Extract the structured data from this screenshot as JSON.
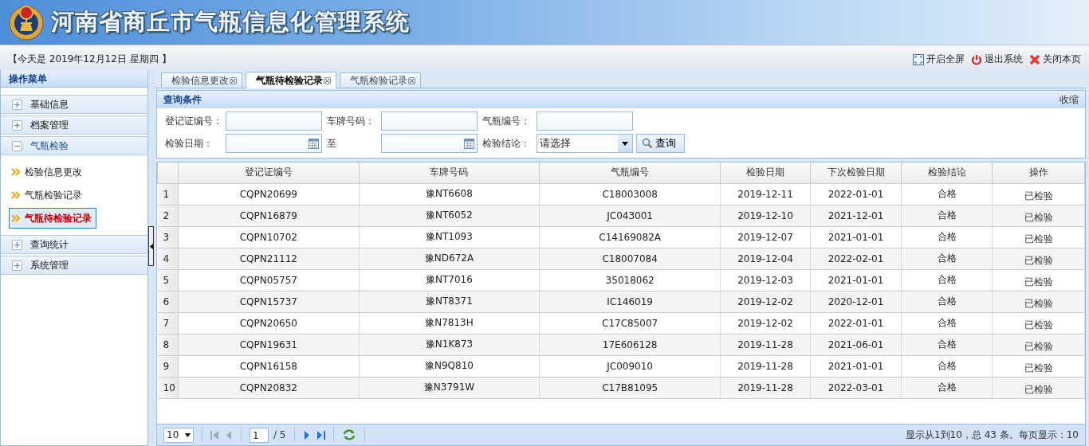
{
  "header": {
    "title": "河南省商丘市气瓶信息化管理系统",
    "date_text": "【今天是 2019年12月12日 星期四 】",
    "actions": [
      {
        "kind": "fullscreen",
        "label": "开启全屏"
      },
      {
        "kind": "logout",
        "label": "退出系统"
      },
      {
        "kind": "close",
        "label": "关闭本页"
      }
    ]
  },
  "sidebar": {
    "title": "操作菜单",
    "groups": [
      {
        "label": "基础信息",
        "expanded": false
      },
      {
        "label": "档案管理",
        "expanded": false
      },
      {
        "label": "气瓶检验",
        "expanded": true,
        "children": [
          {
            "label": "检验信息更改",
            "selected": false
          },
          {
            "label": "气瓶检验记录",
            "selected": false
          },
          {
            "label": "气瓶待检验记录",
            "selected": true
          }
        ]
      },
      {
        "label": "查询统计",
        "expanded": false
      },
      {
        "label": "系统管理",
        "expanded": false
      }
    ]
  },
  "tabs": [
    {
      "label": "检验信息更改",
      "selected": false
    },
    {
      "label": "气瓶待检验记录",
      "selected": true
    },
    {
      "label": "气瓶检验记录",
      "selected": false
    }
  ],
  "query": {
    "title": "查询条件",
    "collapse": "收缩",
    "rows": [
      [
        {
          "kind": "text",
          "label": "登记证编号："
        },
        {
          "kind": "text",
          "label": "车牌号码："
        },
        {
          "kind": "text",
          "label": "气瓶编号："
        }
      ],
      [
        {
          "kind": "date",
          "label": "检验日期："
        },
        {
          "kind": "date",
          "label": "至"
        },
        {
          "kind": "select",
          "label": "检验结论：",
          "value": "请选择"
        },
        {
          "kind": "button",
          "label": "查询"
        }
      ]
    ]
  },
  "table": {
    "columns": [
      "登记证编号",
      "车牌号码",
      "气瓶编号",
      "检验日期",
      "下次检验日期",
      "检验结论",
      "操作"
    ],
    "rows": [
      {
        "index": "1",
        "cells": [
          "CQPN20699",
          "豫NT6608",
          "C18003008",
          "2019-12-11",
          "2022-01-01",
          "合格",
          "已检验"
        ]
      },
      {
        "index": "2",
        "cells": [
          "CQPN16879",
          "豫NT6052",
          "JC043001",
          "2019-12-10",
          "2021-12-01",
          "合格",
          "已检验"
        ]
      },
      {
        "index": "3",
        "cells": [
          "CQPN10702",
          "豫NT1093",
          "C14169082A",
          "2019-12-07",
          "2021-01-01",
          "合格",
          "已检验"
        ]
      },
      {
        "index": "4",
        "cells": [
          "CQPN21112",
          "豫ND672A",
          "C18007084",
          "2019-12-04",
          "2022-02-01",
          "合格",
          "已检验"
        ]
      },
      {
        "index": "5",
        "cells": [
          "CQPN05757",
          "豫NT7016",
          "35018062",
          "2019-12-03",
          "2021-01-01",
          "合格",
          "已检验"
        ]
      },
      {
        "index": "6",
        "cells": [
          "CQPN15737",
          "豫NT8371",
          "IC146019",
          "2019-12-02",
          "2020-12-01",
          "合格",
          "已检验"
        ]
      },
      {
        "index": "7",
        "cells": [
          "CQPN20650",
          "豫N7813H",
          "C17C85007",
          "2019-12-02",
          "2022-01-01",
          "合格",
          "已检验"
        ]
      },
      {
        "index": "8",
        "cells": [
          "CQPN19631",
          "豫N1K873",
          "17E606128",
          "2019-11-28",
          "2021-06-01",
          "合格",
          "已检验"
        ]
      },
      {
        "index": "9",
        "cells": [
          "CQPN16158",
          "豫N9Q810",
          "JC009010",
          "2019-11-28",
          "2021-01-01",
          "合格",
          "已检验"
        ]
      },
      {
        "index": "10",
        "cells": [
          "CQPN20832",
          "豫N3791W",
          "C17B81095",
          "2019-11-28",
          "2022-03-01",
          "合格",
          "已检验"
        ]
      }
    ]
  },
  "pager": {
    "page_size": "10",
    "page": "1",
    "total_pages": "/ 5",
    "info": "显示从1到10，总 43 条。每页显示：10"
  }
}
